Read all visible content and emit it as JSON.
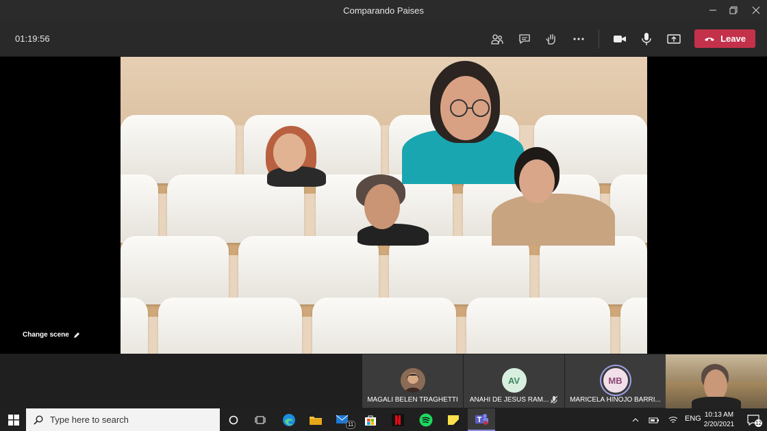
{
  "window": {
    "title": "Comparando Paises"
  },
  "call": {
    "timer": "01:19:56",
    "leave_label": "Leave"
  },
  "stage": {
    "change_scene_label": "Change scene"
  },
  "participants": [
    {
      "name": "MAGALI BELEN TRAGHETTI",
      "initials": ""
    },
    {
      "name": "ANAHI DE JESUS RAM...",
      "initials": "AV"
    },
    {
      "name": "MARICELA HINOJO BARRI...",
      "initials": "MB"
    }
  ],
  "taskbar": {
    "search_placeholder": "Type here to search",
    "mail_badge": "11",
    "tray_lang": "ENG",
    "clock_time": "10:13 AM",
    "clock_date": "2/20/2021",
    "notification_count": "12"
  },
  "colors": {
    "leave": "#c4314b",
    "teams": "#5b5fc7",
    "accent": "#2b88d8"
  }
}
